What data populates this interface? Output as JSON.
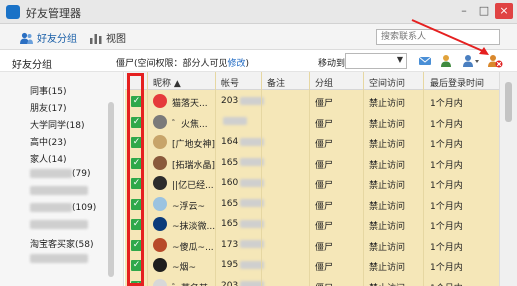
{
  "window": {
    "title": "好友管理器",
    "min_glyph": "–",
    "max_glyph": "□",
    "close_glyph": "×"
  },
  "toolbar": {
    "friends_label": "好友分组",
    "view_label": "视图",
    "search_placeholder": "搜索联系人"
  },
  "subheader": {
    "side_title": "好友分组",
    "group_info": "僵尸(空间权限：部分人可见",
    "edit_label": "修改",
    "group_info_close": ")",
    "move_label": "移动到"
  },
  "sidebar": {
    "items": [
      {
        "label": "同事(15)",
        "blur": false
      },
      {
        "label": "朋友(17)",
        "blur": false
      },
      {
        "label": "大学同学(18)",
        "blur": false
      },
      {
        "label": "高中(23)",
        "blur": false
      },
      {
        "label": "家人(14)",
        "blur": false
      },
      {
        "label": "(79)",
        "blur": true
      },
      {
        "label": "",
        "blur": true
      },
      {
        "label": "(109)",
        "blur": true
      },
      {
        "label": "",
        "blur": true
      },
      {
        "label": "淘宝客买家(58)",
        "blur": false
      },
      {
        "label": "",
        "blur": true
      }
    ]
  },
  "table": {
    "headers": {
      "nick": "昵称 ▲",
      "account": "帐号",
      "note": "备注",
      "group": "分组",
      "access": "空间访问",
      "last_login": "最后登录时间"
    },
    "rows": [
      {
        "checked": "✓",
        "avatar_color": "#e53a3a",
        "nick": "猫落天...",
        "account": "203",
        "group": "僵尸",
        "access": "禁止访问",
        "last": "1个月内"
      },
      {
        "checked": "✓",
        "avatar_color": "#7a7a7a",
        "nick": "゛火焦...",
        "account": "",
        "group": "僵尸",
        "access": "禁止访问",
        "last": "1个月内"
      },
      {
        "checked": "✓",
        "avatar_color": "#c7a46a",
        "nick": "[广地女神]",
        "account": "164",
        "group": "僵尸",
        "access": "禁止访问",
        "last": "1个月内"
      },
      {
        "checked": "✓",
        "avatar_color": "#8a5a3c",
        "nick": "[拓瑞水晶]",
        "account": "165",
        "group": "僵尸",
        "access": "禁止访问",
        "last": "1个月内"
      },
      {
        "checked": "✓",
        "avatar_color": "#2c2c2c",
        "nick": "||亿已经...",
        "account": "160",
        "group": "僵尸",
        "access": "禁止访问",
        "last": "1个月内"
      },
      {
        "checked": "✓",
        "avatar_color": "#9bc3e0",
        "nick": "~浮云~",
        "account": "165",
        "group": "僵尸",
        "access": "禁止访问",
        "last": "1个月内"
      },
      {
        "checked": "✓",
        "avatar_color": "#0b3b7a",
        "nick": "~抹淡微...",
        "account": "165",
        "group": "僵尸",
        "access": "禁止访问",
        "last": "1个月内"
      },
      {
        "checked": "✓",
        "avatar_color": "#b84a2a",
        "nick": "~傻瓜~...",
        "account": "173",
        "group": "僵尸",
        "access": "禁止访问",
        "last": "1个月内"
      },
      {
        "checked": "✓",
        "avatar_color": "#1e1e1e",
        "nick": "~烟~",
        "account": "195",
        "group": "僵尸",
        "access": "禁止访问",
        "last": "1个月内"
      },
      {
        "checked": "✓",
        "avatar_color": "#d8d8d8",
        "nick": "゛莫名其...",
        "account": "203",
        "group": "僵尸",
        "access": "禁止访问",
        "last": "1个月内"
      }
    ]
  },
  "colors": {
    "row_highlight": "#f5e7b8",
    "annotation_red": "#e52020",
    "checkbox_green": "#2fa84a"
  }
}
